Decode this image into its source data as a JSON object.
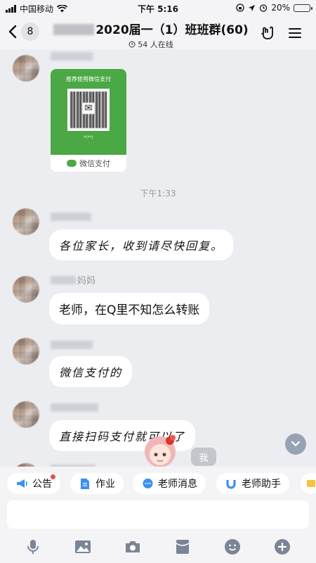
{
  "status_bar": {
    "carrier": "中国移动",
    "time": "下午 5:16",
    "battery": "20%",
    "battery_level": 0.2
  },
  "header": {
    "back_count": "8",
    "title": "2020届一（1）班班群(60)",
    "online": "54 人在线"
  },
  "messages": {
    "pay_card": {
      "recommend": "推荐使用微信支付",
      "small_label": "*(**)",
      "brand": "微信支付"
    },
    "timestamp": "下午1:33",
    "msg1": "各位家长，收到请尽快回复。",
    "msg2_sender_suffix": "妈妈",
    "msg2": "老师，在Q里不知怎么转账",
    "msg3": "微信支付的",
    "msg4": "直接扫码支付就可以了",
    "me_label": "我"
  },
  "quick_bar": {
    "items": [
      {
        "label": "公告",
        "color": "#3a8ff7"
      },
      {
        "label": "作业",
        "color": "#3a8ff7"
      },
      {
        "label": "老师消息",
        "color": "#3a8ff7"
      },
      {
        "label": "老师助手",
        "color": "#3a8ff7"
      }
    ]
  },
  "input": {
    "placeholder": ""
  },
  "colors": {
    "accent": "#3a8ff7",
    "wechat_green": "#4aa845",
    "badge_red": "#f24a4a"
  }
}
